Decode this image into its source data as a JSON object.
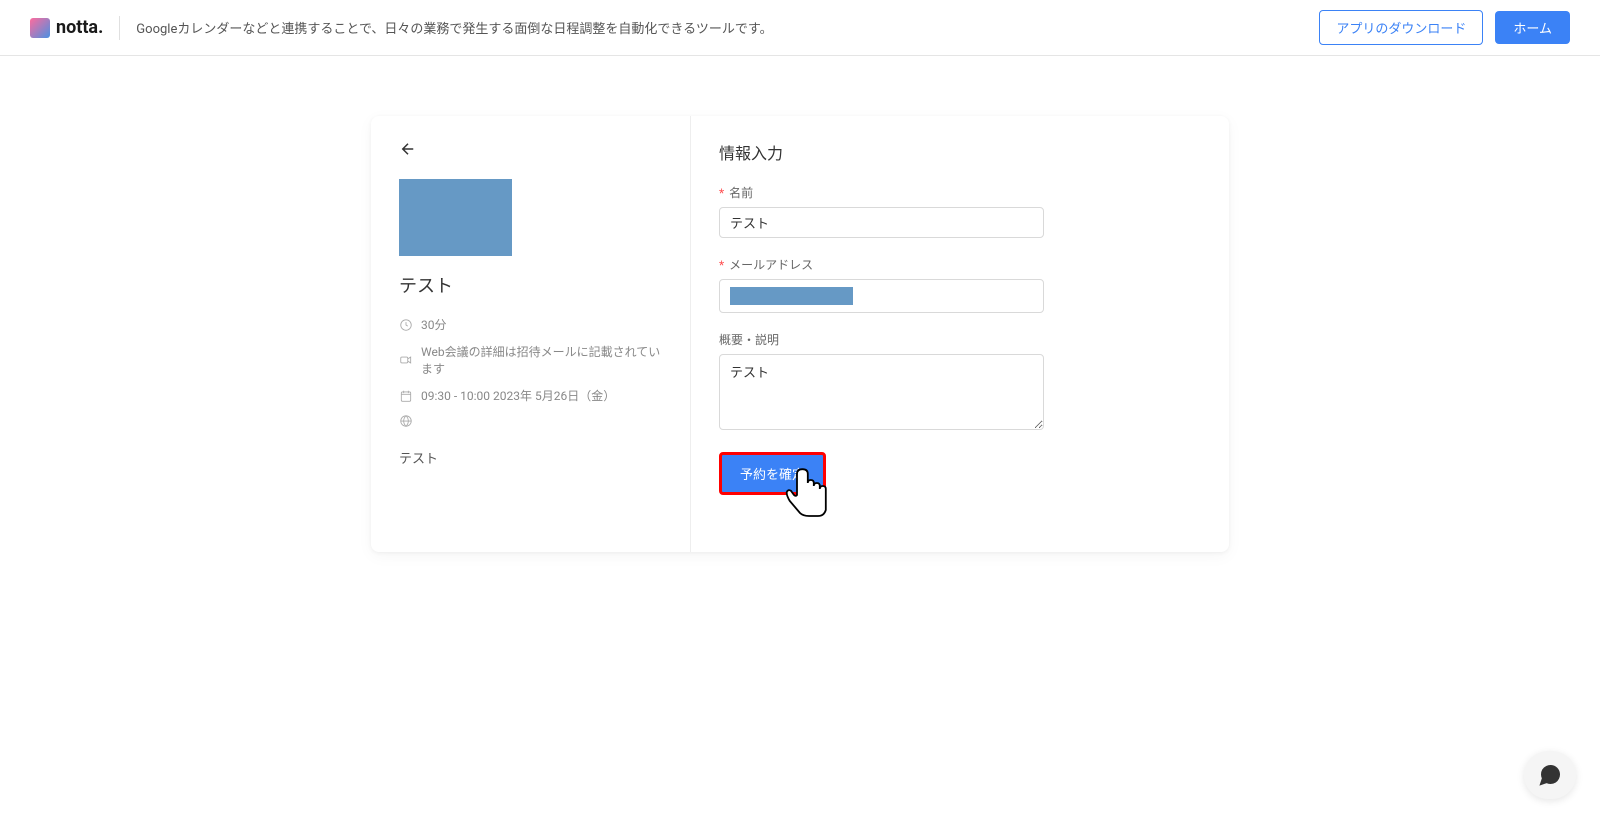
{
  "header": {
    "logo_text": "notta.",
    "tagline": "Googleカレンダーなどと連携することで、日々の業務で発生する面倒な日程調整を自動化できるツールです。",
    "download_label": "アプリのダウンロード",
    "home_label": "ホーム"
  },
  "sidebar": {
    "event_title": "テスト",
    "duration": "30分",
    "meeting_info": "Web会議の詳細は招待メールに記載されています",
    "datetime": "09:30 - 10:00 2023年 5月26日（金）",
    "description": "テスト"
  },
  "form": {
    "title": "情報入力",
    "name_label": "名前",
    "name_value": "テスト",
    "email_label": "メールアドレス",
    "desc_label": "概要・説明",
    "desc_value": "テスト",
    "submit_label": "予約を確定"
  }
}
